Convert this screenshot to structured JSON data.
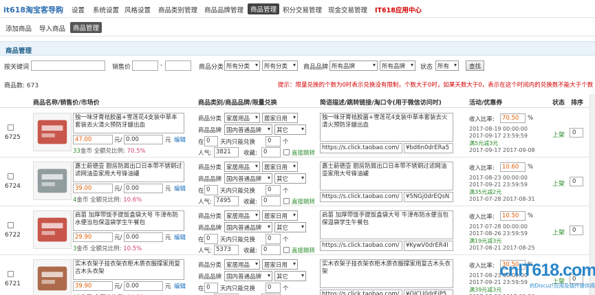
{
  "topnav": {
    "logo": "it618淘宝客导购",
    "items": [
      {
        "label": "设置"
      },
      {
        "label": "系统设置"
      },
      {
        "label": "风格设置"
      },
      {
        "label": "商品类别管理"
      },
      {
        "label": "商品品牌管理"
      },
      {
        "label": "商品管理",
        "active": true
      },
      {
        "label": "积分交易管理"
      },
      {
        "label": "现金交易管理"
      },
      {
        "label": "IT618应用中心",
        "highlight": true
      }
    ]
  },
  "subnav": {
    "items": [
      {
        "label": "添加商品"
      },
      {
        "label": "导入商品"
      },
      {
        "label": "商品管理",
        "active": true
      }
    ]
  },
  "section": {
    "title": "商品管理"
  },
  "filter": {
    "keyword_label": "按关键词",
    "keyword_value": "",
    "price_label": "销售价",
    "price_sep": "-",
    "category_label": "商品分类",
    "category1": "所有分类",
    "category2": "所有分类",
    "brand_label": "商品品牌",
    "brand1": "所有品牌",
    "brand2": "所有品牌",
    "status_label": "状态",
    "status": "所有",
    "search_button": "查找"
  },
  "summary": {
    "count_label": "商品数:",
    "count": "673",
    "tip": "提示：限量兑换的个数为0时表示兑换没有限制，个数大于0时，如果天数大于0，表示在这个时间内的兑换数不能大于个数"
  },
  "table": {
    "headers": {
      "name": "商品名称/销售价/市场价",
      "category": "商品类别/商品品牌/限量兑换",
      "desc": "简语描述/跳转链接/淘口令(用于微信访问时)",
      "activity": "活动/优惠券",
      "status": "状态",
      "sort": "排序"
    },
    "labels": {
      "category": "商品分类",
      "brand": "商品品牌",
      "in": "在",
      "in_suffix": "天内只能兑换",
      "times": "个",
      "popularity": "人气:",
      "collect": "收藏:",
      "direct": "直接跳转",
      "unit_yuan": "元/",
      "unit_yuan2": "元",
      "edit": "编辑",
      "coin_suffix": "金币 全额兑比例:",
      "ratio_label": "收入比率:",
      "percent": "%",
      "on_shelf": "上架",
      "sort_value": "0",
      "zero": "0"
    },
    "rows": [
      {
        "id": "6725",
        "thumb_color": "#c0392b",
        "title": "独一味牙膏祛胶菌+雪莲花4支装中草本套装去火清火预防牙龈出血",
        "price": "47.00",
        "market": "0.00",
        "coins": "33",
        "ratio": "70.5%",
        "cat1": "家居用品",
        "cat2": "居家日用",
        "brand1": "国内普通品牌",
        "brand2": "其它",
        "popularity": "3821",
        "desc": "独一味牙膏祛胶菌+雪莲花4支装中草本套装去火清火预防牙龈出血",
        "url": "https://s.click.taobao.com/",
        "code": "¥bd6n0drERa5",
        "income": "70.50",
        "start": "2017-08-19 00:00:00",
        "end": "2017-09-17 23:59:59",
        "coupon": "满5元减3元",
        "coupon_range": "2017-09-17 2017-09-08"
      },
      {
        "id": "6724",
        "thumb_color": "#7f8c8d",
        "title": "嘉士蔚德壶 厨房防屑出口日本带不锈钢过滤网油壶家用大号锋油罐",
        "price": "39.00",
        "market": "0.00",
        "coins": "4",
        "ratio": "10.6%",
        "cat1": "家居用品",
        "cat2": "居家日用",
        "brand1": "国内普通品牌",
        "brand2": "其它",
        "popularity": "7495",
        "desc": "嘉士蔚德壶 厨房防屑出口日本带不锈钢过滤网油壶家用大号锋油罐",
        "url": "https://s.click.taobao.com/",
        "code": "¥5NGj0drEQsN",
        "income": "10.60",
        "start": "2017-08-23 00:00:00",
        "end": "2017-09-21 23:59:59",
        "coupon": "满35元减2元",
        "coupon_range": "2017-07-28 2017-08-31"
      },
      {
        "id": "6722",
        "thumb_color": "#c0392b",
        "title": "启苗 加厚带饭手提饭盒袋大号 牛津布防水便当包保温袋学生午餐包",
        "price": "29.90",
        "market": "0.00",
        "coins": "3",
        "ratio": "10.5%",
        "cat1": "家居用品",
        "cat2": "居家日用",
        "brand1": "国内普通品牌",
        "brand2": "其它",
        "popularity": "5373",
        "desc": "启苗 加厚带饭手提饭盒袋大号 牛津布防水便当包保温袋学生午餐包",
        "url": "https://s.click.taobao.com/",
        "code": "¥KywV0drER4I",
        "income": "10.50",
        "start": "2017-07-28 00:00:00",
        "end": "2017-08-26 23:59:59",
        "coupon": "满19元减3元",
        "coupon_range": "2017-08-21 2017-08-25"
      },
      {
        "id": "6721",
        "thumb_color": "#a0522d",
        "title": "实木衣架子挂衣架衣柜木质衣服撑家用复古木头衣架",
        "price": "39.90",
        "market": "0.00",
        "coins": "12",
        "ratio": "30.5%",
        "cat1": "家居用品",
        "cat2": "居家日用",
        "brand1": "国内普通品牌",
        "brand2": "其它",
        "popularity": "4066",
        "desc": "实木衣架子挂衣架衣柜木质衣服撑家用复古木头衣架",
        "url": "https://s.click.taobao.com/",
        "code": "¥OICU0drEiP5",
        "income": "30.50",
        "start": "2017-08-23 00:00:00",
        "end": "2017-09-21 23:59:59",
        "coupon": "满39元减3元",
        "coupon_range": "2017-08-23 2017-08-26"
      }
    ]
  },
  "watermark": {
    "main": "cnIT618.com",
    "sub": "的Discuz!应用及插件提供商"
  },
  "colors": {
    "accent_blue": "#1f5f8b",
    "price_orange": "#e35a00",
    "link_green": "#2a8b2a",
    "tip_red": "#d20000",
    "section_bg": "#eaf3f9"
  }
}
